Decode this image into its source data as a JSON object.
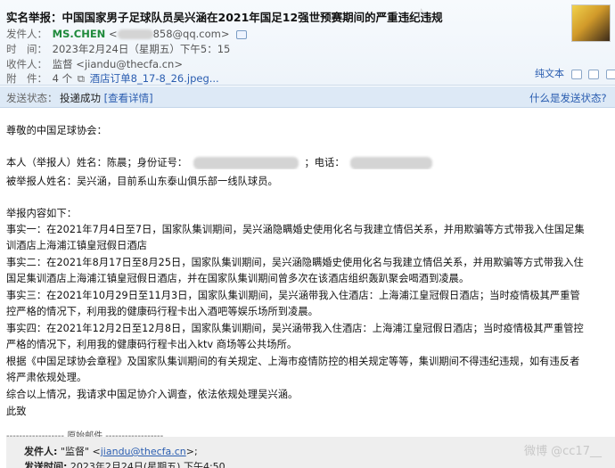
{
  "header": {
    "subject": "实名举报：中国国家男子足球队员吴兴涵在2021年国足12强世预赛期间的严重违纪违规",
    "star_icon": "☆",
    "from_label": "发件人：",
    "from_name": "MS.CHEN",
    "from_email_open": "<",
    "from_email_tail": "858@qq.com>",
    "time_label": "时　间：",
    "time_value": "2023年2月24日（星期五）下午5：15",
    "to_label": "收件人：",
    "to_value": "监督 <jiandu@thecfa.cn>",
    "attach_label": "附　件：",
    "attach_count": "4 个",
    "attach_name": "酒店订单8_17-8_26.jpeg...",
    "plain_text": "纯文本"
  },
  "status": {
    "label": "发送状态：",
    "value": "投递成功",
    "detail": "[查看详情]",
    "help": "什么是发送状态?"
  },
  "letter": {
    "greeting": "尊敬的中国足球协会：",
    "reporter_prefix": "本人（举报人）姓名：陈晨；身份证号：",
    "reporter_phone": "；电话：",
    "accused": "被举报人姓名：吴兴涵，目前系山东泰山俱乐部一线队球员。",
    "content_title": "举报内容如下：",
    "lines": [
      "事实一：在2021年7月4日至7日，国家队集训期间，吴兴涵隐瞒婚史使用化名与我建立情侣关系，并用欺骗等方式带我入住国足集",
      "训酒店上海浦江镇皇冠假日酒店",
      "事实二：在2021年8月17日至8月25日，国家队集训期间，吴兴涵隐瞒婚史使用化名与我建立情侣关系，并用欺骗等方式带我入住",
      "国足集训酒店上海浦江镇皇冠假日酒店，并在国家队集训期间曾多次在该酒店组织轰趴聚会喝酒到凌晨。",
      "事实三：在2021年10月29日至11月3日，国家队集训期间，吴兴涵带我入住酒店：上海浦江皇冠假日酒店；当时疫情极其严重管",
      "控严格的情况下，利用我的健康码行程卡出入酒吧等娱乐场所到凌晨。",
      "事实四：在2021年12月2日至12月8日，国家队集训期间，吴兴涵带我入住酒店：上海浦江皇冠假日酒店；当时疫情极其严重管控",
      "严格的情况下，利用我的健康码行程卡出入ktv 商场等公共场所。",
      "根据《中国足球协会章程》及国家队集训期间的有关规定、上海市疫情防控的相关规定等等，集训期间不得违纪违规，如有违反者",
      "将严肃依规处理。",
      "综合以上情况，我请求中国足协介入调查，依法依规处理吴兴涵。",
      "此致"
    ]
  },
  "original": {
    "separator": "------------------ 原始邮件 ------------------",
    "from_label": "发件人:",
    "from_value_prefix": "\"监督\" <",
    "from_link": "jiandu@thecfa.cn",
    "from_value_suffix": ">;",
    "time_label": "发送时间:",
    "time_value": "2023年2月24日(星期五) 下午4:50"
  },
  "watermark": "微博 @cc17__"
}
